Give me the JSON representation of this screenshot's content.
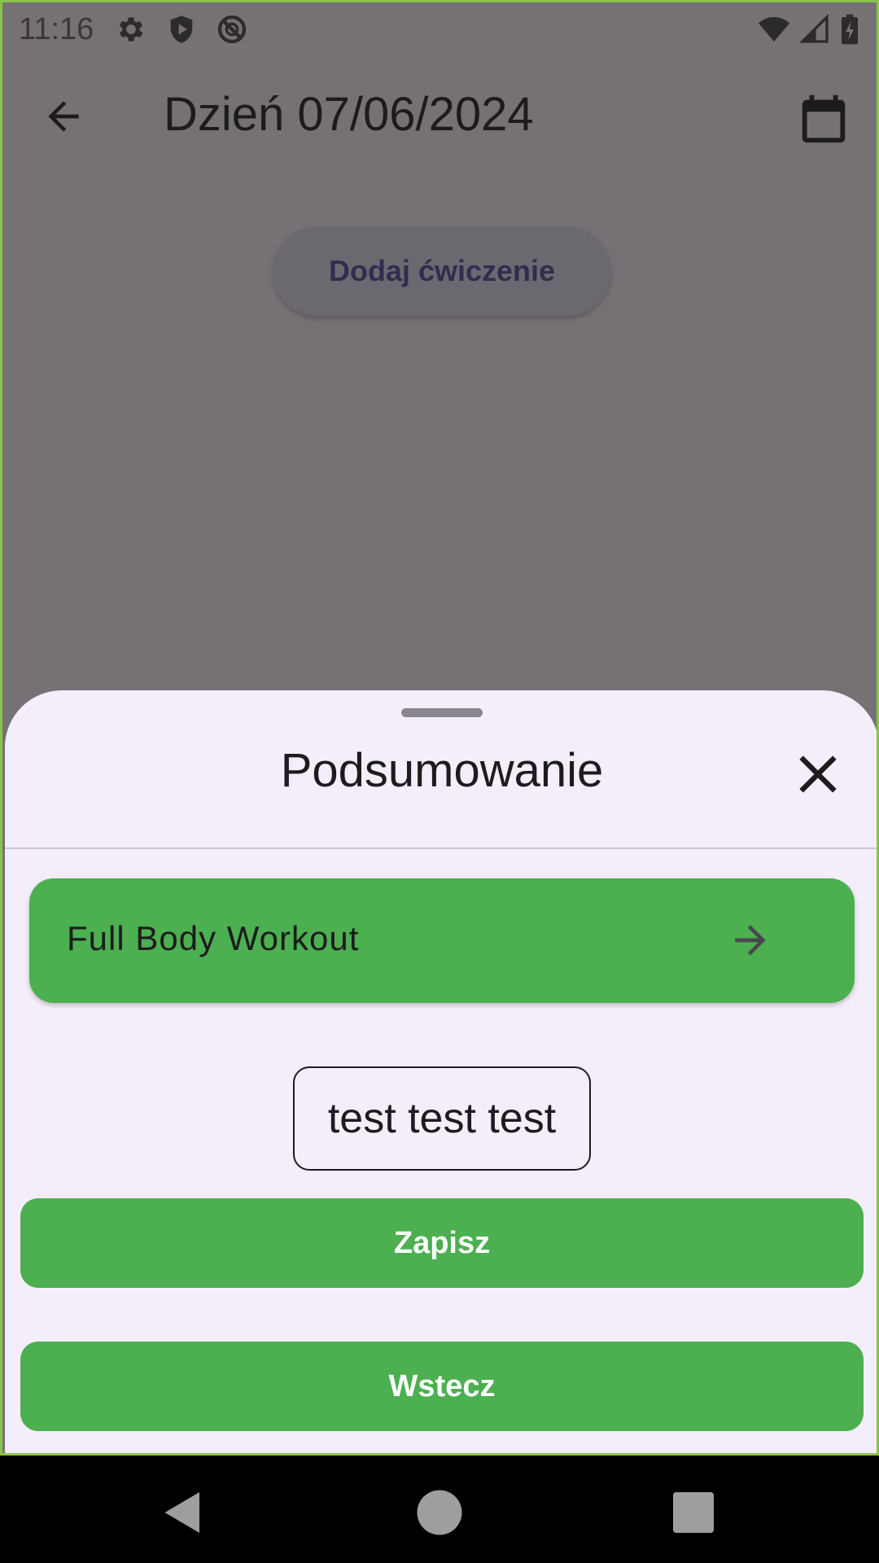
{
  "status_bar": {
    "time": "11:16",
    "left_icons": [
      "gear-icon",
      "shield-play-icon",
      "no-sync-icon"
    ],
    "right_icons": [
      "wifi-icon",
      "signal-icon",
      "battery-charging-icon"
    ]
  },
  "app_bar": {
    "title": "Dzień 07/06/2024",
    "back_icon": "arrow-left-icon",
    "calendar_icon": "calendar-icon"
  },
  "main": {
    "add_exercise_label": "Dodaj ćwiczenie"
  },
  "sheet": {
    "title": "Podsumowanie",
    "close_icon": "close-icon",
    "workout": {
      "name": "Full Body Workout",
      "arrow_icon": "arrow-right-icon"
    },
    "note": "test test test",
    "save_label": "Zapisz",
    "back_label": "Wstecz"
  },
  "colors": {
    "accent_green": "#4caf50",
    "sheet_background": "#f4eefa",
    "scrim": "#767175",
    "frame_border": "#8bc34a"
  },
  "nav_bar": {
    "icons": [
      "nav-back-icon",
      "nav-home-icon",
      "nav-recents-icon"
    ]
  }
}
